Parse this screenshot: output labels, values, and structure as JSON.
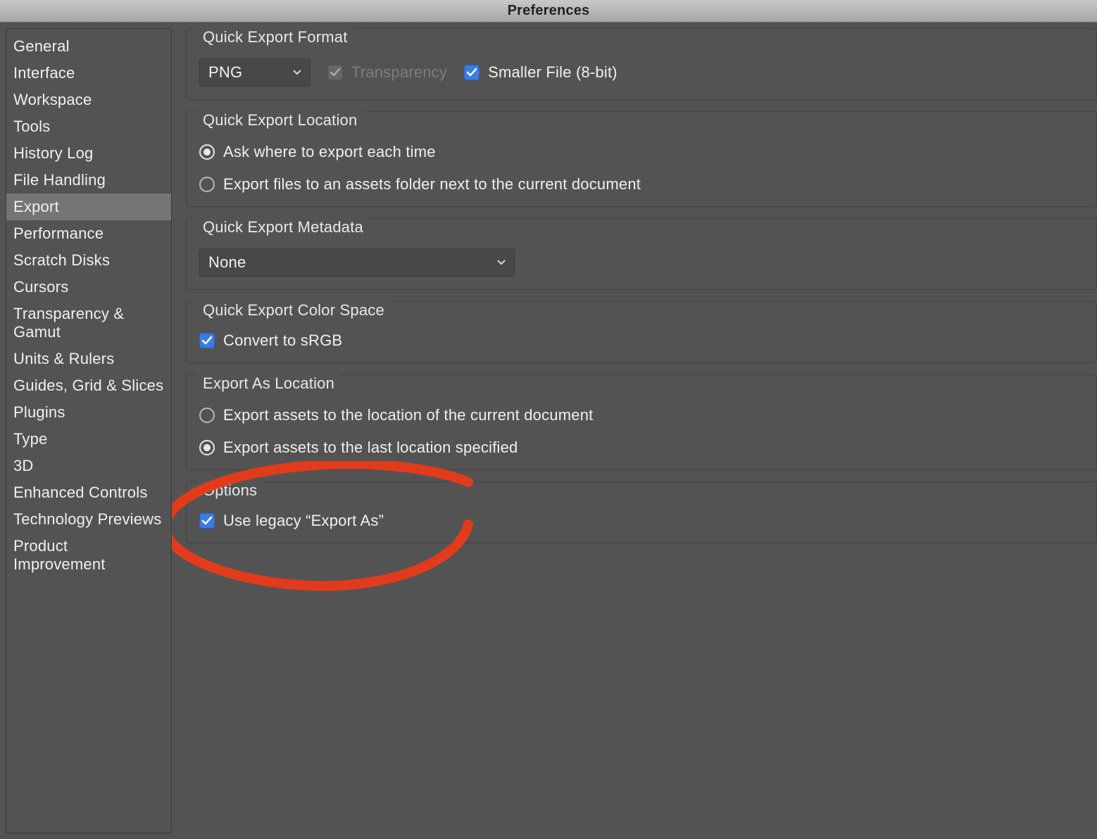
{
  "window": {
    "title": "Preferences"
  },
  "sidebar": {
    "items": [
      {
        "label": "General"
      },
      {
        "label": "Interface"
      },
      {
        "label": "Workspace"
      },
      {
        "label": "Tools"
      },
      {
        "label": "History Log"
      },
      {
        "label": "File Handling"
      },
      {
        "label": "Export"
      },
      {
        "label": "Performance"
      },
      {
        "label": "Scratch Disks"
      },
      {
        "label": "Cursors"
      },
      {
        "label": "Transparency & Gamut"
      },
      {
        "label": "Units & Rulers"
      },
      {
        "label": "Guides, Grid & Slices"
      },
      {
        "label": "Plugins"
      },
      {
        "label": "Type"
      },
      {
        "label": "3D"
      },
      {
        "label": "Enhanced Controls"
      },
      {
        "label": "Technology Previews"
      },
      {
        "label": "Product Improvement"
      }
    ],
    "active_index": 6
  },
  "sections": {
    "format": {
      "legend": "Quick Export Format",
      "format_select": "PNG",
      "transparency_label": "Transparency",
      "smaller_file_label": "Smaller File (8-bit)"
    },
    "location": {
      "legend": "Quick Export Location",
      "opt_ask": "Ask where to export each time",
      "opt_assets": "Export files to an assets folder next to the current document"
    },
    "metadata": {
      "legend": "Quick Export Metadata",
      "select_value": "None"
    },
    "colorspace": {
      "legend": "Quick Export Color Space",
      "convert_srgb": "Convert to sRGB"
    },
    "exportas_location": {
      "legend": "Export As Location",
      "opt_current": "Export assets to the location of the current document",
      "opt_last": "Export assets to the last location specified"
    },
    "options": {
      "legend": "Options",
      "legacy_export": "Use legacy “Export As”"
    }
  }
}
